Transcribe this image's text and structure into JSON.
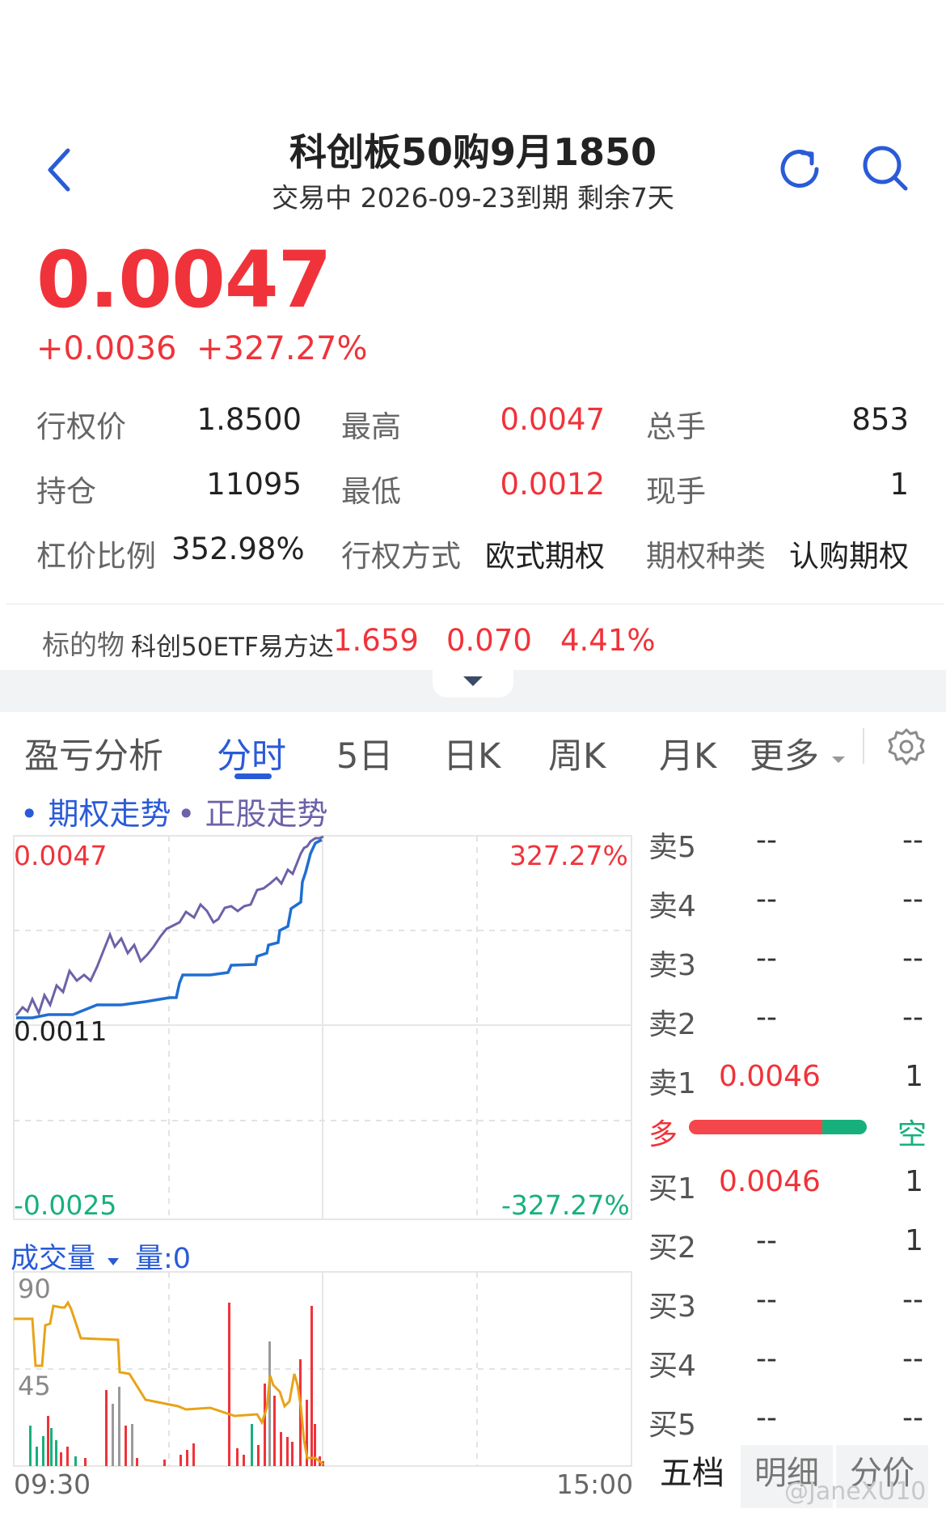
{
  "header": {
    "title": "科创板50购9月1850",
    "subtitle": "交易中 2026-09-23到期 剩余7天"
  },
  "quote": {
    "price": "0.0047",
    "change": "+0.0036",
    "change_pct": "+327.27%"
  },
  "stats": {
    "strike_label": "行权价",
    "strike_value": "1.8500",
    "high_label": "最高",
    "high_value": "0.0047",
    "volume_label": "总手",
    "volume_value": "853",
    "oi_label": "持仓",
    "oi_value": "11095",
    "low_label": "最低",
    "low_value": "0.0012",
    "cur_label": "现手",
    "cur_value": "1",
    "leverage_label": "杠价比例",
    "leverage_value": "352.98%",
    "exercise_label": "行权方式",
    "exercise_value": "欧式期权",
    "type_label": "期权种类",
    "type_value": "认购期权"
  },
  "underlying": {
    "label": "标的物",
    "name": "科创50ETF易方达",
    "price": "1.659",
    "change": "0.070",
    "change_pct": "4.41%"
  },
  "tabs": {
    "items": [
      "盈亏分析",
      "分时",
      "5日",
      "日K",
      "周K",
      "月K"
    ],
    "more": "更多",
    "active_index": 1
  },
  "legend": {
    "option": "期权走势",
    "stock": "正股走势"
  },
  "intraday": {
    "top_left": "0.0047",
    "top_right": "327.27%",
    "mid_left": "0.0011",
    "bottom_left": "-0.0025",
    "bottom_right": "-327.27%"
  },
  "volume": {
    "label": "成交量",
    "qty_label": "量:0",
    "tick_high": "90",
    "tick_mid": "45",
    "time_start": "09:30",
    "time_end": "15:00"
  },
  "order_book": {
    "asks": [
      {
        "label": "卖5",
        "price": "--",
        "qty": "--"
      },
      {
        "label": "卖4",
        "price": "--",
        "qty": "--"
      },
      {
        "label": "卖3",
        "price": "--",
        "qty": "--"
      },
      {
        "label": "卖2",
        "price": "--",
        "qty": "--"
      },
      {
        "label": "卖1",
        "price": "0.0046",
        "qty": "1"
      }
    ],
    "bull_label": "多",
    "bear_label": "空",
    "bull_ratio": 0.75,
    "bids": [
      {
        "label": "买1",
        "price": "0.0046",
        "qty": "1"
      },
      {
        "label": "买2",
        "price": "--",
        "qty": "1"
      },
      {
        "label": "买3",
        "price": "--",
        "qty": "--"
      },
      {
        "label": "买4",
        "price": "--",
        "qty": "--"
      },
      {
        "label": "买5",
        "price": "--",
        "qty": "--"
      }
    ]
  },
  "bottom_tabs": [
    "五档",
    "明细",
    "分价"
  ],
  "watermark": "@JaneXU10",
  "colors": {
    "up": "#f0333a",
    "down": "#17b07c",
    "accent": "#2a5bd7",
    "option_line": "#6b62a8",
    "stock_line": "#1f6fd1",
    "avg_line": "#e8a317"
  },
  "chart_data": {
    "type": "line",
    "x": [
      "09:30",
      "15:00"
    ],
    "series": [
      {
        "name": "期权走势"
      },
      {
        "name": "正股走势"
      }
    ],
    "y_left_range": [
      -0.0025,
      0.0047
    ],
    "y_right_range": [
      "-327.27%",
      "327.27%"
    ],
    "volume_ticks": [
      45,
      90
    ],
    "grid": true
  }
}
